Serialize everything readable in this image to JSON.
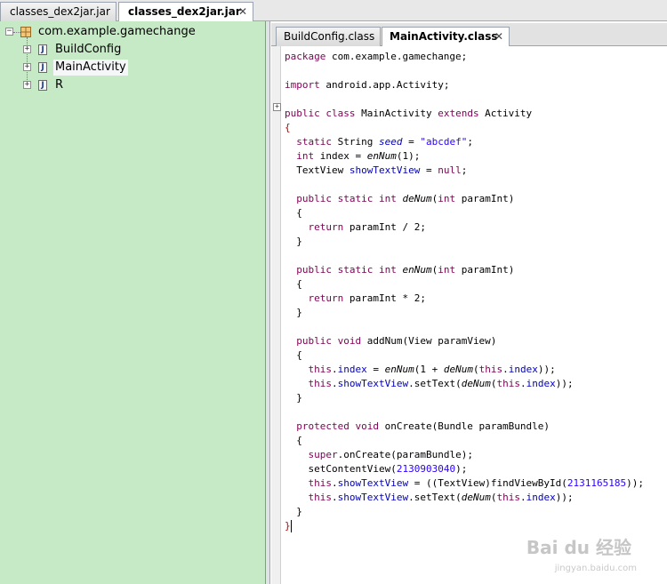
{
  "file_tabs": [
    {
      "label": "classes_dex2jar.jar",
      "active": false
    },
    {
      "label": "classes_dex2jar.jar",
      "active": true,
      "close": "✕"
    }
  ],
  "tree": {
    "package": "com.example.gamechange",
    "classes": [
      "BuildConfig",
      "MainActivity",
      "R"
    ],
    "selected": "MainActivity"
  },
  "editor_tabs": [
    {
      "label": "BuildConfig.class",
      "active": false
    },
    {
      "label": "MainActivity.class",
      "active": true,
      "close": "✕"
    }
  ],
  "code": {
    "package_kw": "package",
    "package_name": " com.example.gamechange;",
    "import_kw": "import",
    "import_name": " android.app.Activity;",
    "class_decl": [
      "public class",
      " MainActivity ",
      "extends",
      " Activity"
    ],
    "open_brace": "{",
    "close_brace": "}",
    "fields": {
      "seed": [
        "static",
        " String ",
        "seed",
        " = ",
        "\"abcdef\"",
        ";"
      ],
      "index": [
        "int",
        " index = ",
        "enNum",
        "(1);"
      ],
      "view": [
        "TextView ",
        "showTextView",
        " = ",
        "null",
        ";"
      ]
    },
    "deNum": {
      "sig": [
        "public static int",
        " ",
        "deNum",
        "(",
        "int",
        " paramInt)"
      ],
      "body": [
        "return",
        " paramInt / 2;"
      ]
    },
    "enNum": {
      "sig": [
        "public static int",
        " ",
        "enNum",
        "(",
        "int",
        " paramInt)"
      ],
      "body": [
        "return",
        " paramInt * 2;"
      ]
    },
    "addNum": {
      "sig": [
        "public void",
        " addNum(View paramView)"
      ],
      "line1": [
        "this",
        ".",
        "index",
        " = ",
        "enNum",
        "(1 + ",
        "deNum",
        "(",
        "this",
        ".",
        "index",
        "));"
      ],
      "line2": [
        "this",
        ".",
        "showTextView",
        ".setText(",
        "deNum",
        "(",
        "this",
        ".",
        "index",
        "));"
      ]
    },
    "onCreate": {
      "sig": [
        "protected void",
        " onCreate(Bundle paramBundle)"
      ],
      "line1": [
        "super",
        ".onCreate(paramBundle);"
      ],
      "line2": [
        "setContentView(",
        "2130903040",
        ");"
      ],
      "line3": [
        "this",
        ".",
        "showTextView",
        " = ((TextView)findViewById(",
        "2131165185",
        "));"
      ],
      "line4": [
        "this",
        ".",
        "showTextView",
        ".setText(",
        "deNum",
        "(",
        "this",
        ".",
        "index",
        "));"
      ]
    }
  },
  "watermark": {
    "text": "Bai du 经验",
    "sub": "jingyan.baidu.com"
  },
  "colors": {
    "tree_bg": "#c6e9c6",
    "keyword": "#7f0055",
    "string": "#2a00ff",
    "field": "#0000c0",
    "brace": "#c00000"
  }
}
